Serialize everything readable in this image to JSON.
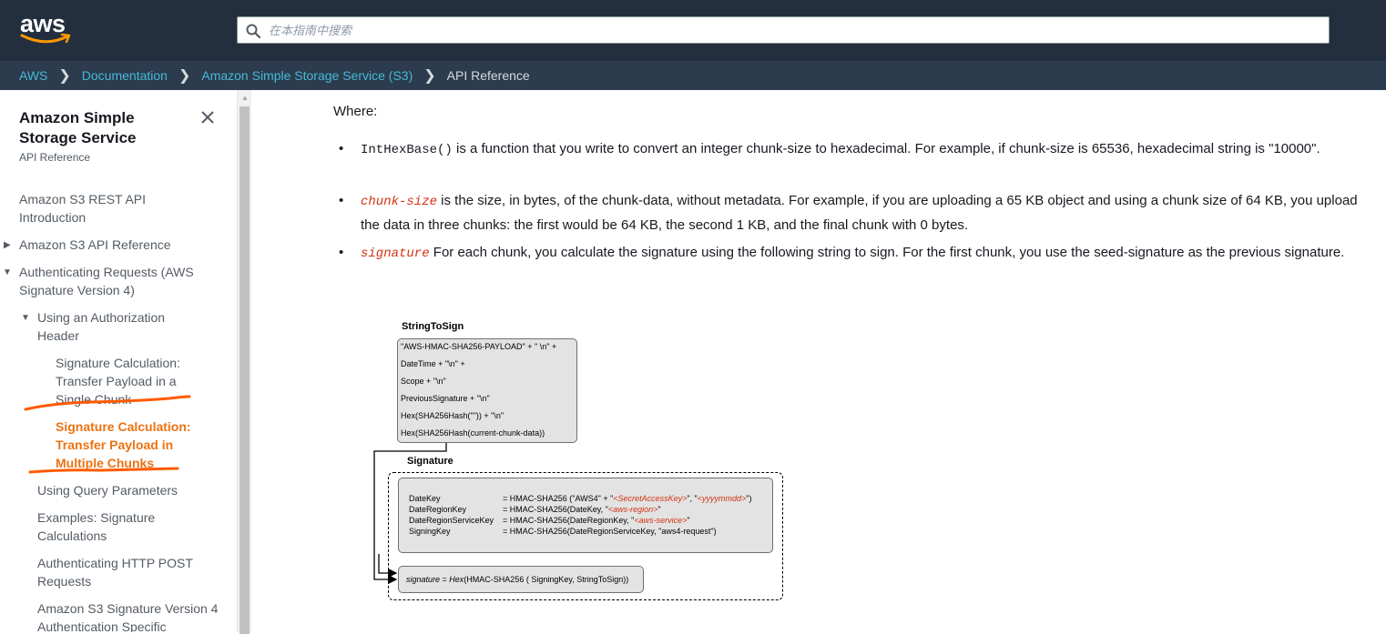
{
  "header": {
    "logo_text": "aws",
    "search_placeholder": "在本指南中搜索"
  },
  "breadcrumb": {
    "items": [
      "AWS",
      "Documentation",
      "Amazon Simple Storage Service (S3)"
    ],
    "current": "API Reference"
  },
  "sidebar": {
    "title": "Amazon Simple Storage Service",
    "subtitle": "API Reference",
    "items": [
      {
        "label": "Amazon S3 REST API Introduction"
      },
      {
        "label": "Amazon S3 API Reference"
      },
      {
        "label": "Authenticating Requests (AWS Signature Version 4)"
      },
      {
        "label": "Using an Authorization Header"
      },
      {
        "label": "Signature Calculation: Transfer Payload in a Single Chunk"
      },
      {
        "label": "Signature Calculation: Transfer Payload in Multiple Chunks"
      },
      {
        "label": "Using Query Parameters"
      },
      {
        "label": "Examples: Signature Calculations"
      },
      {
        "label": "Authenticating HTTP POST Requests"
      },
      {
        "label": "Amazon S3 Signature Version 4 Authentication Specific"
      }
    ]
  },
  "content": {
    "where": "Where:",
    "bullets": [
      {
        "code": "IntHexBase()",
        "text": " is a function that you write to convert an integer chunk-size to hexadecimal. For example, if chunk-size is 65536, hexadecimal string is \"10000\"."
      },
      {
        "code": "chunk-size",
        "text": " is the size, in bytes, of the chunk-data, without metadata. For example, if you are uploading a 65 KB object and using a chunk size of 64 KB, you upload the data in three chunks: the first would be 64 KB, the second 1 KB, and the final chunk with 0 bytes."
      },
      {
        "code": "signature",
        "text": " For each chunk, you calculate the signature using the following string to sign. For the first chunk, you use the seed-signature as the previous signature."
      }
    ]
  },
  "diagram": {
    "sts_label": "StringToSign",
    "sts_lines": [
      "\"AWS-HMAC-SHA256-PAYLOAD\" + \" \\n\" +",
      "DateTime + \"\\n\" +",
      "Scope + \"\\n\"",
      "PreviousSignature + \"\\n\"",
      "Hex(SHA256Hash(\"\")) + \"\\n\"",
      "Hex(SHA256Hash(current-chunk-data))"
    ],
    "sig_label": "Signature",
    "keys": [
      {
        "name": "DateKey",
        "pre": "= HMAC-SHA256 (\"AWS4\" + \"",
        "red1": "<SecretAccessKey>",
        "mid": "\", \"",
        "red2": "<yyyymmdd>",
        "post": "\")"
      },
      {
        "name": "DateRegionKey",
        "pre": "= HMAC-SHA256(DateKey, \"",
        "red1": "<aws-region>",
        "mid": "\"",
        "red2": "",
        "post": ""
      },
      {
        "name": "DateRegionServiceKey",
        "pre": "= HMAC-SHA256(DateRegionKey, \"",
        "red1": "<aws-service>",
        "mid": "\"",
        "red2": "",
        "post": ""
      },
      {
        "name": "SigningKey",
        "pre": "= HMAC-SHA256(DateRegionServiceKey, \"aws4-request\")",
        "red1": "",
        "mid": "",
        "red2": "",
        "post": ""
      }
    ],
    "final_sig": "signature",
    "final_eq": " =  ",
    "final_hex": "Hex",
    "final_rest": "(HMAC-SHA256 ( SigningKey, StringToSign))"
  },
  "colors": {
    "topbar": "#232f3e",
    "crumbbar": "#2c3b4e",
    "link": "#44b9d6",
    "active": "#ec7211",
    "code_var": "#d13212",
    "annotation": "#ff5a00"
  }
}
